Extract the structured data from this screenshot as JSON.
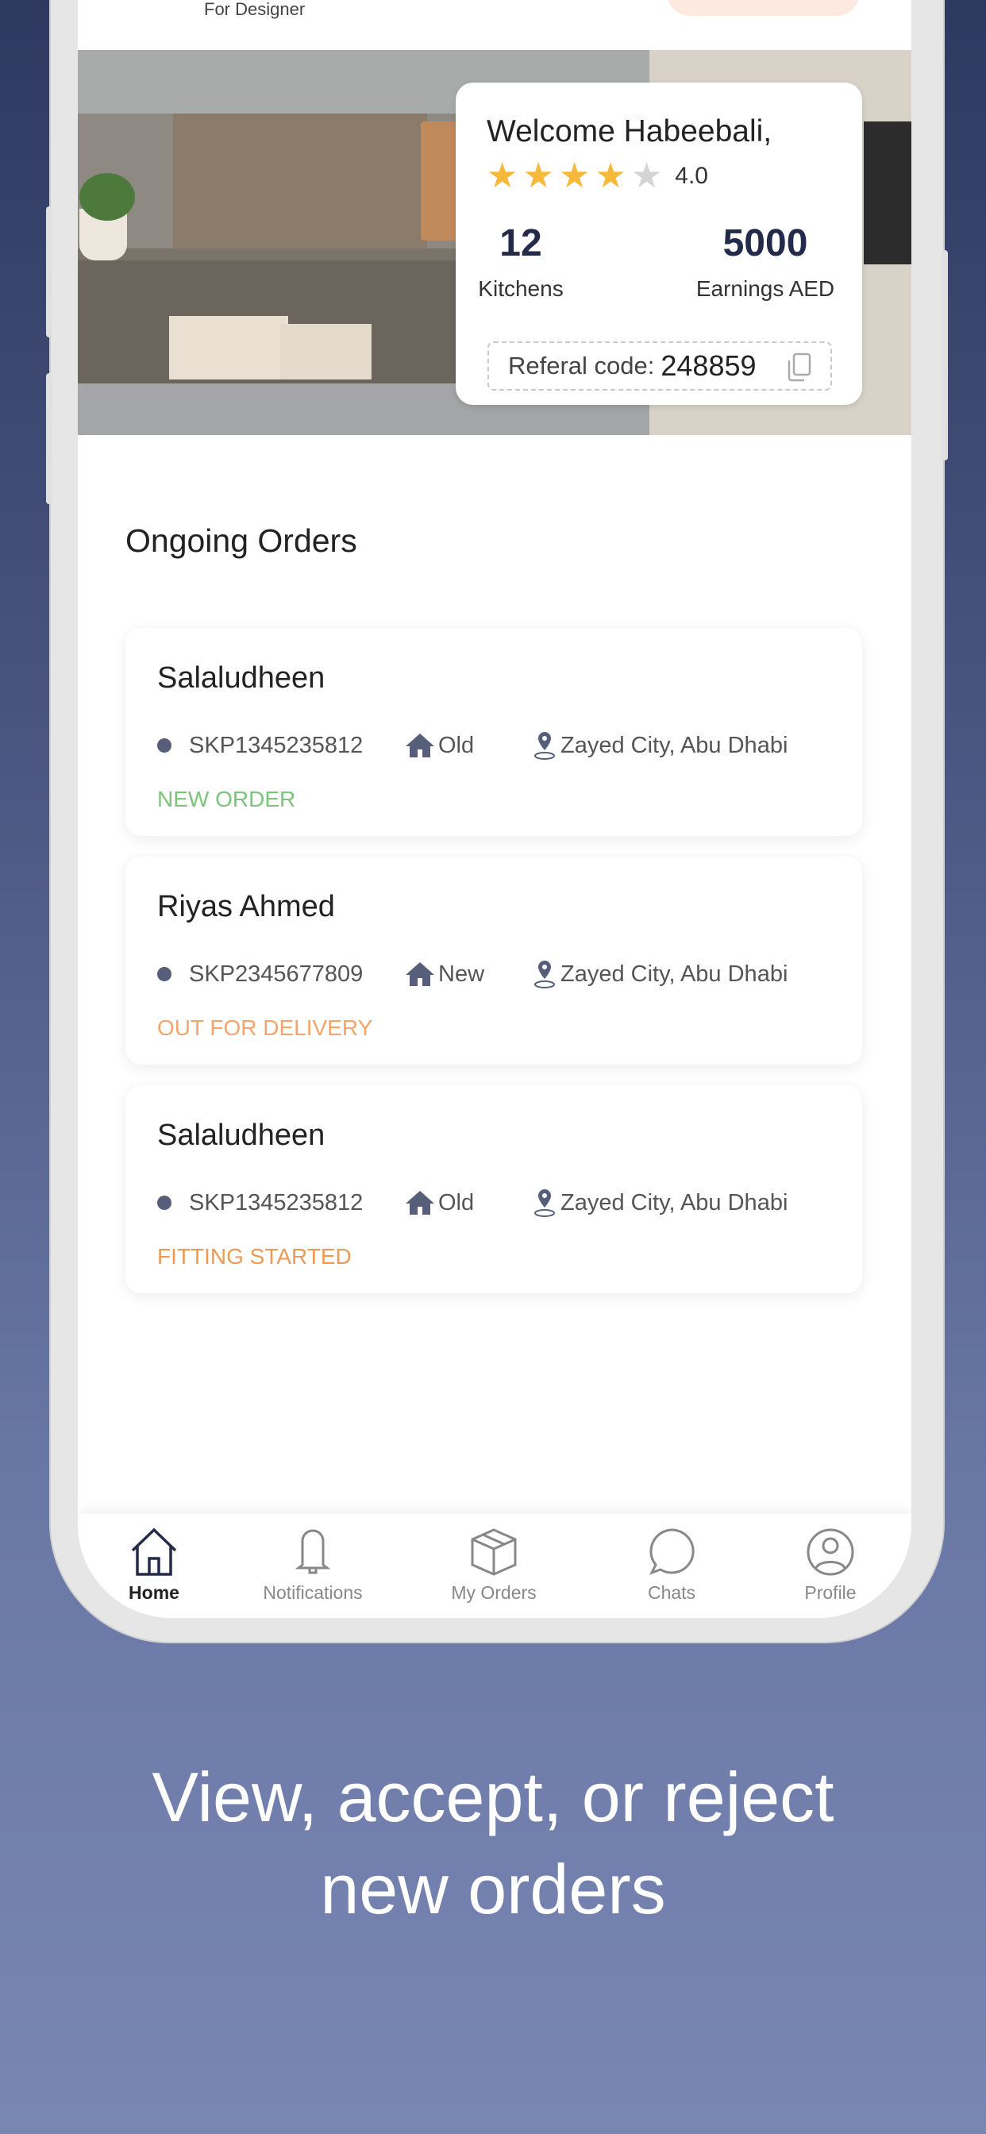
{
  "header": {
    "tagline": "For Designer"
  },
  "welcome": {
    "greeting": "Welcome Habeebali,",
    "rating": "4.0",
    "rating_value": 4,
    "rating_max": 5,
    "stats": [
      {
        "value": "12",
        "label": "Kitchens"
      },
      {
        "value": "5000",
        "label": "Earnings AED"
      }
    ],
    "referral_label": "Referal code:",
    "referral_code": "248859"
  },
  "section_title": "Ongoing Orders",
  "orders": [
    {
      "name": "Salaludheen",
      "id": "SKP1345235812",
      "type": "Old",
      "location": "Zayed City, Abu Dhabi",
      "status": "NEW ORDER",
      "status_color": "#7cc47a"
    },
    {
      "name": "Riyas Ahmed",
      "id": "SKP2345677809",
      "type": "New",
      "location": "Zayed City, Abu Dhabi",
      "status": "OUT FOR DELIVERY",
      "status_color": "#f5a46b"
    },
    {
      "name": "Salaludheen",
      "id": "SKP1345235812",
      "type": "Old",
      "location": "Zayed City, Abu Dhabi",
      "status": "FITTING STARTED",
      "status_color": "#ee9a55"
    }
  ],
  "nav": [
    {
      "label": "Home",
      "icon": "home-icon",
      "active": true
    },
    {
      "label": "Notifications",
      "icon": "bell-icon"
    },
    {
      "label": "My Orders",
      "icon": "box-icon"
    },
    {
      "label": "Chats",
      "icon": "chat-icon"
    },
    {
      "label": "Profile",
      "icon": "profile-icon"
    }
  ],
  "caption": {
    "line1": "View, accept, or reject",
    "line2": "new orders"
  },
  "colors": {
    "accent_dark": "#242b4a",
    "star": "#f6b93b",
    "background_top": "#2e3960",
    "background_bottom": "#7986b2"
  }
}
